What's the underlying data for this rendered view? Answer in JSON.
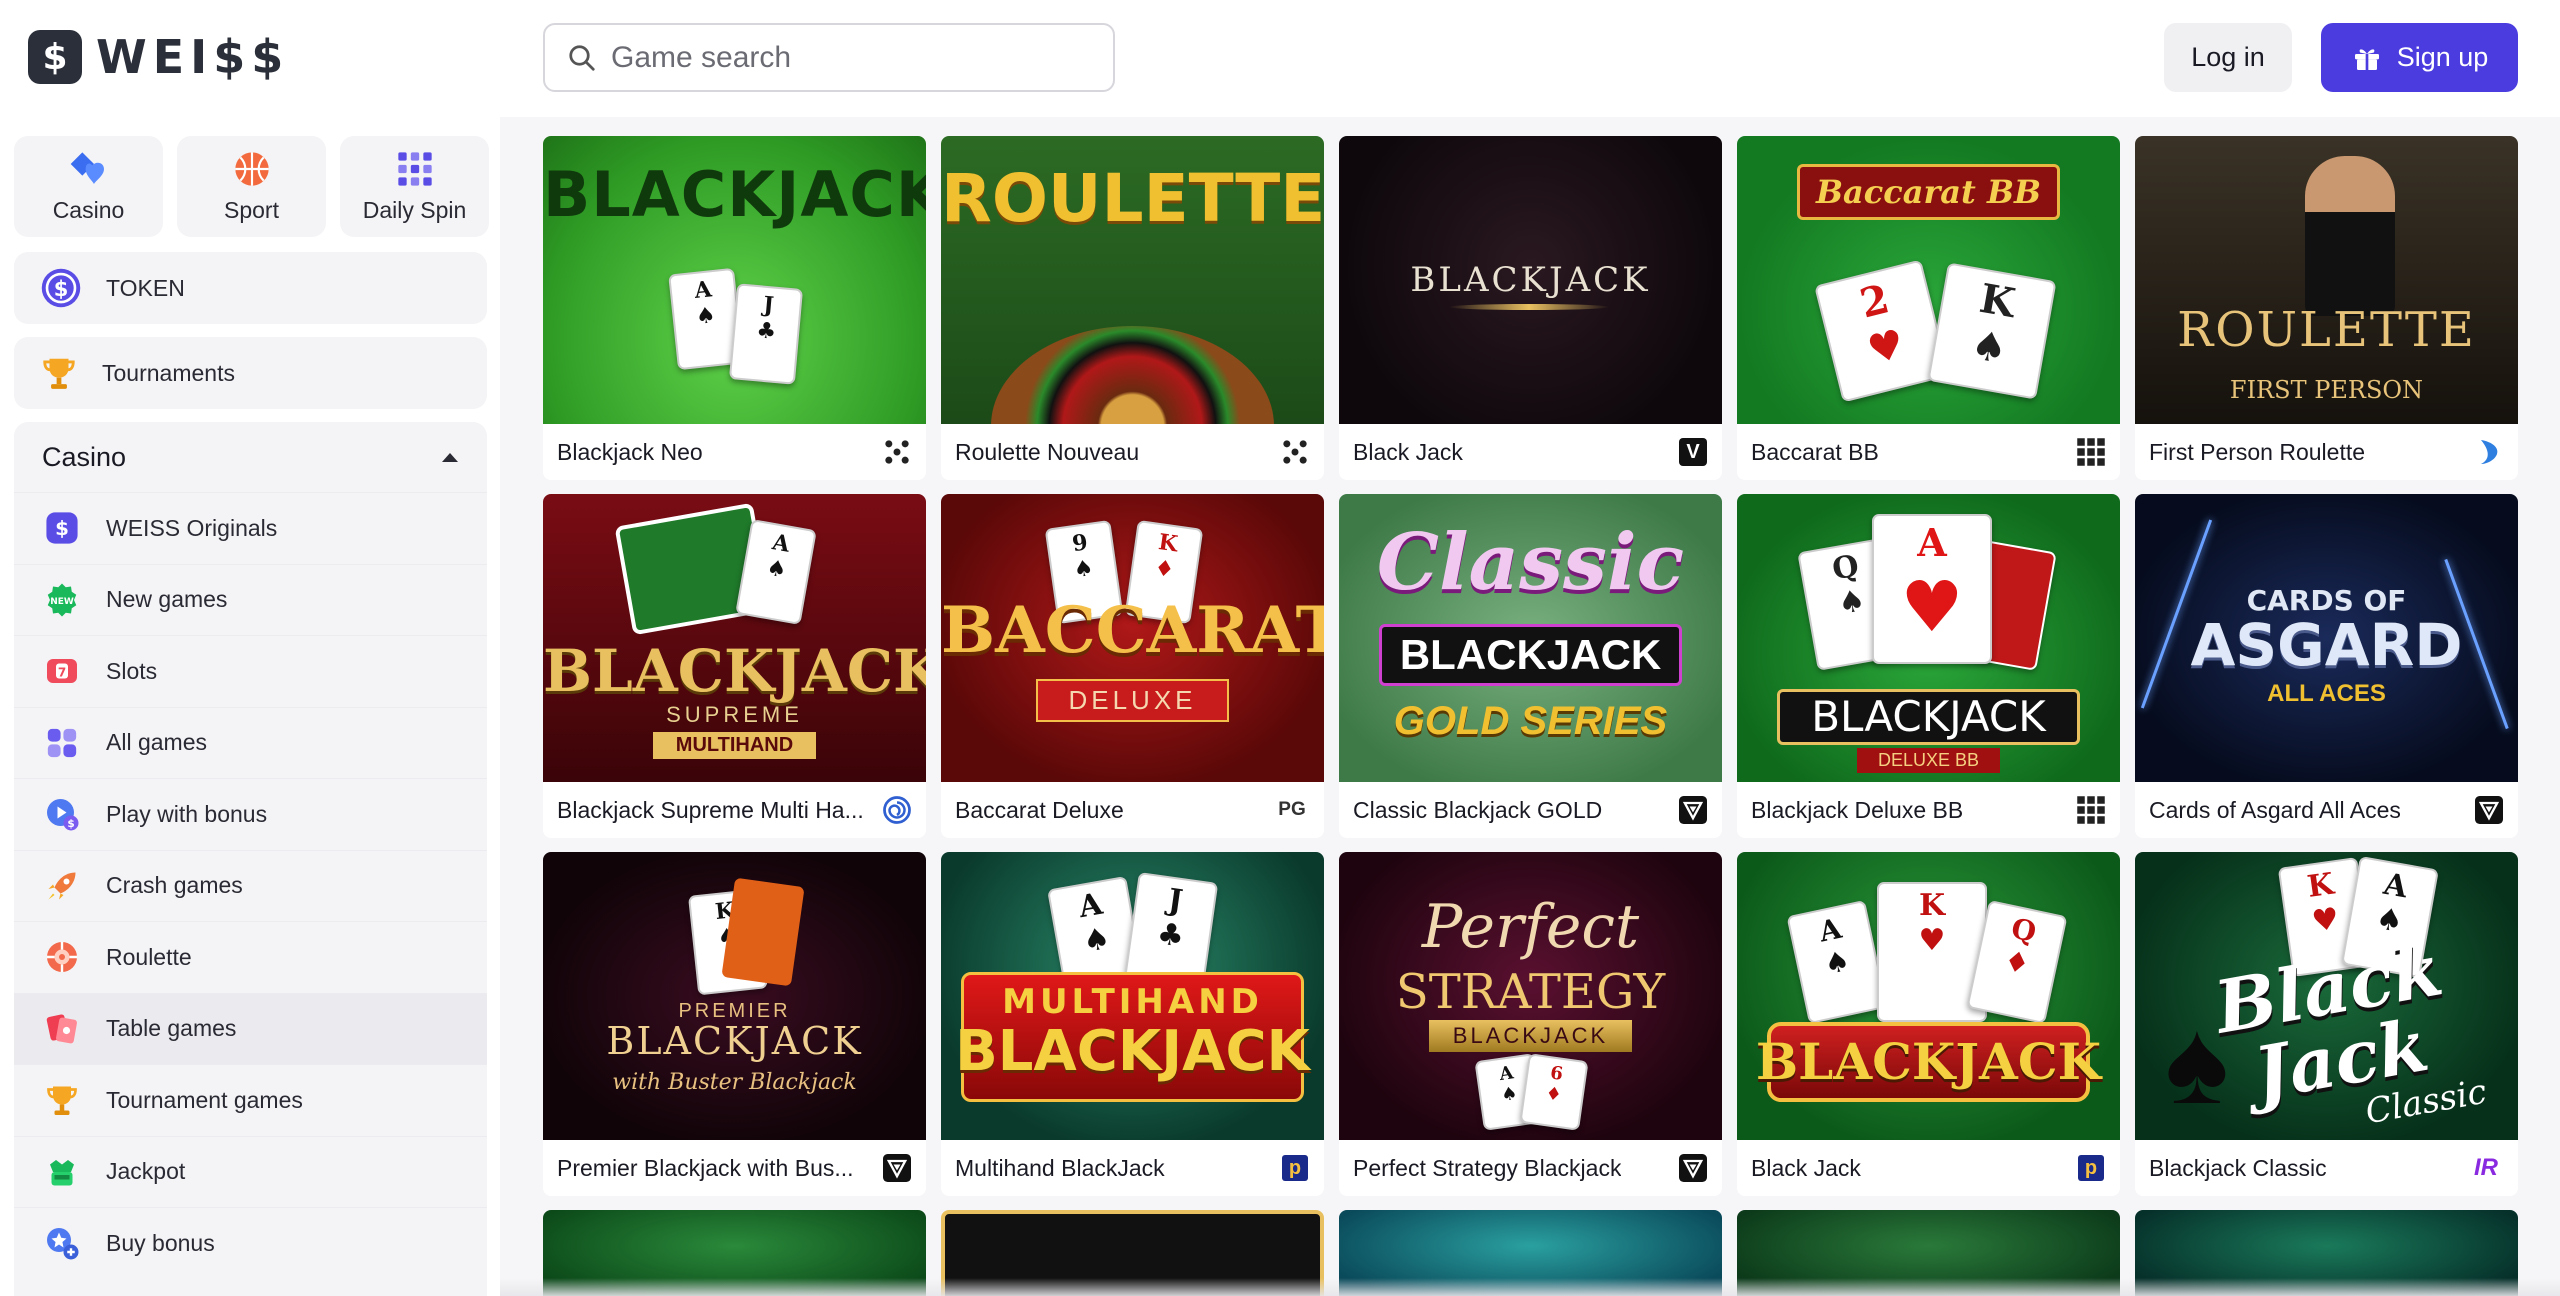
{
  "brand": {
    "name": "WEI$$",
    "mark": "$"
  },
  "search": {
    "placeholder": "Game search"
  },
  "auth": {
    "login_label": "Log in",
    "signup_label": "Sign up"
  },
  "sidebar": {
    "tiles": [
      {
        "label": "Casino",
        "icon": "casino-icon"
      },
      {
        "label": "Sport",
        "icon": "basketball-icon"
      },
      {
        "label": "Daily Spin",
        "icon": "daily-spin-icon"
      }
    ],
    "token_label": "TOKEN",
    "tournaments_label": "Tournaments",
    "casino_section": {
      "title": "Casino",
      "items": [
        {
          "label": "WEISS Originals",
          "icon": "originals-icon"
        },
        {
          "label": "New games",
          "icon": "new-badge-icon",
          "badge": "NEW"
        },
        {
          "label": "Slots",
          "icon": "slots-icon"
        },
        {
          "label": "All games",
          "icon": "grid-icon"
        },
        {
          "label": "Play with bonus",
          "icon": "bonus-play-icon"
        },
        {
          "label": "Crash games",
          "icon": "rocket-icon"
        },
        {
          "label": "Roulette",
          "icon": "roulette-icon"
        },
        {
          "label": "Table games",
          "icon": "table-games-icon",
          "active": true
        },
        {
          "label": "Tournament games",
          "icon": "trophy-icon"
        },
        {
          "label": "Jackpot",
          "icon": "jackpot-icon"
        },
        {
          "label": "Buy bonus",
          "icon": "buy-bonus-icon"
        }
      ]
    }
  },
  "games": [
    {
      "name": "Blackjack Neo",
      "art": "BLACKJACK",
      "provider_icon": "dots-provider-icon"
    },
    {
      "name": "Roulette Nouveau",
      "art": "ROULETTE",
      "provider_icon": "dots-provider-icon"
    },
    {
      "name": "Black Jack",
      "art": "BLACKJACK",
      "provider_icon": "v-provider-icon"
    },
    {
      "name": "Baccarat BB",
      "art": "Baccarat BB",
      "provider_icon": "grid-provider-icon"
    },
    {
      "name": "First Person Roulette",
      "art": "ROULETTE",
      "art_sub": "FIRST PERSON",
      "provider_icon": "evolution-provider-icon"
    },
    {
      "name": "Blackjack Supreme Multi Ha...",
      "art": "BLACKJACK",
      "art_sub": "SUPREME",
      "art_sub2": "MULTIHAND",
      "provider_icon": "spiral-provider-icon"
    },
    {
      "name": "Baccarat Deluxe",
      "art": "BACCARAT",
      "art_sub": "DELUXE",
      "provider_icon": "pg-provider-icon"
    },
    {
      "name": "Classic Blackjack GOLD",
      "art": "Classic",
      "art_sub": "BLACKJACK",
      "art_sub2": "GOLD SERIES",
      "provider_icon": "triangle-provider-icon"
    },
    {
      "name": "Blackjack Deluxe BB",
      "art": "BLACKJACK",
      "art_sub": "DELUXE BB",
      "provider_icon": "grid-provider-icon"
    },
    {
      "name": "Cards of Asgard All Aces",
      "art": "CARDS OF",
      "art_sub": "ASGARD",
      "art_sub2": "ALL ACES",
      "provider_icon": "triangle-provider-icon"
    },
    {
      "name": "Premier Blackjack with Bus...",
      "art": "BLACKJACK",
      "art_sub": "PREMIER",
      "art_sub2": "with Buster Blackjack",
      "provider_icon": "triangle-provider-icon"
    },
    {
      "name": "Multihand BlackJack",
      "art": "BLACKJACK",
      "art_sub": "MULTIHAND",
      "provider_icon": "p-provider-icon"
    },
    {
      "name": "Perfect Strategy Blackjack",
      "art": "Perfect",
      "art_sub": "STRATEGY",
      "art_sub2": "BLACKJACK",
      "provider_icon": "triangle-provider-icon"
    },
    {
      "name": "Black Jack",
      "art": "BLACKJACK",
      "provider_icon": "p-provider-icon"
    },
    {
      "name": "Blackjack Classic",
      "art": "Black Jack",
      "art_sub": "Classic",
      "provider_icon": "ir-provider-icon"
    }
  ],
  "provider_marks": {
    "v": "V",
    "pg": "PG",
    "p": "p",
    "ir": "IR"
  },
  "colors": {
    "accent": "#4b3ce0",
    "sidebar_bg": "#f4f4f6",
    "active_item_bg": "#ebebef"
  }
}
